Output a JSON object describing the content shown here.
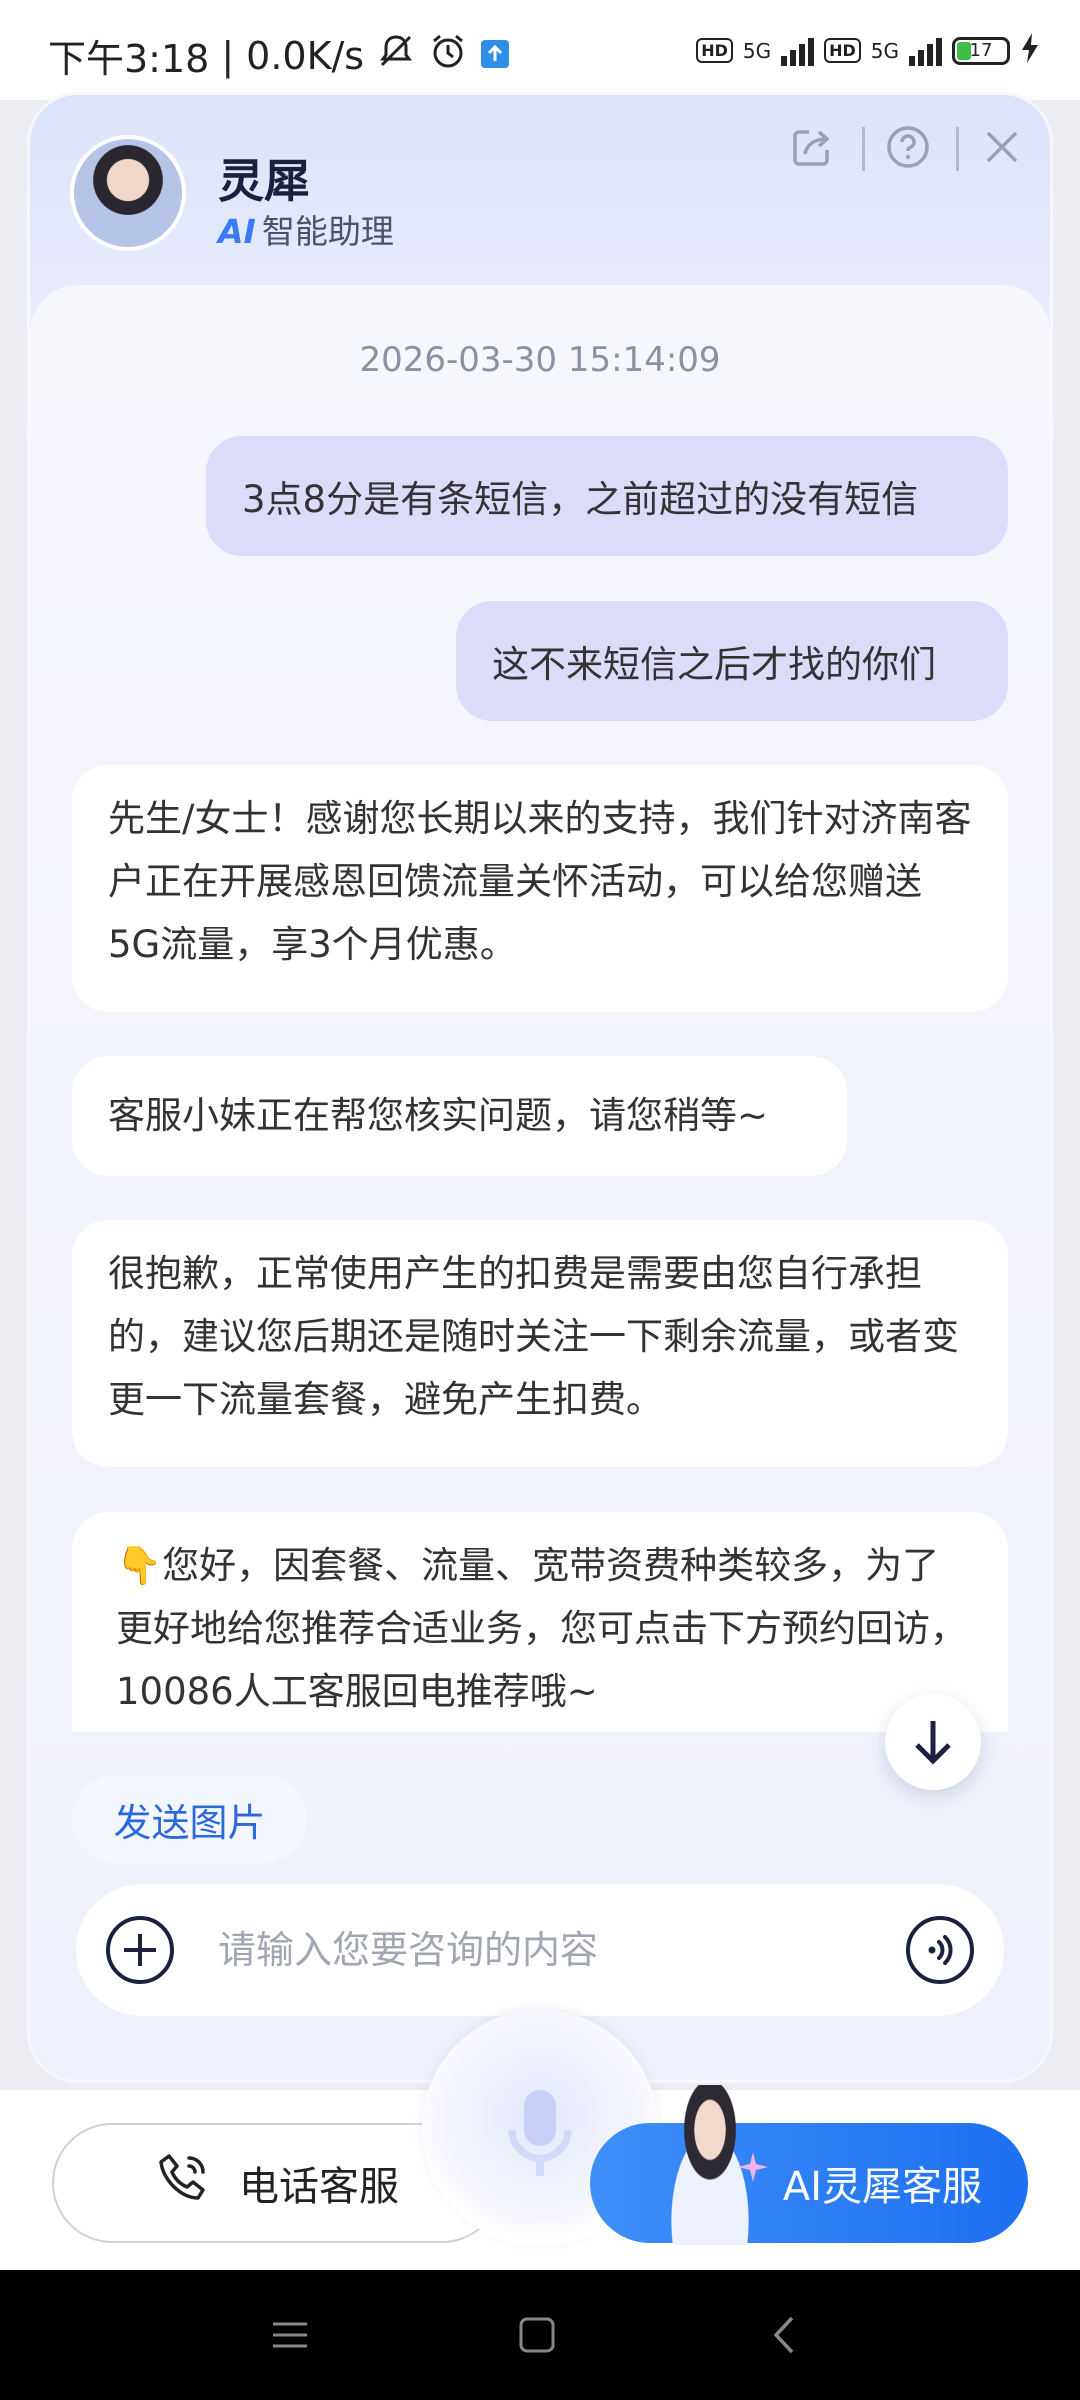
{
  "status_bar": {
    "time": "下午3:18",
    "speed": "0.0K/s",
    "network_1": "5G",
    "network_2": "5G",
    "battery": "17",
    "icons": [
      "mute-icon",
      "alarm-icon",
      "upload-notif-icon",
      "hd-icon",
      "signal-icon",
      "battery-icon",
      "charging-icon"
    ]
  },
  "header": {
    "bot_name": "灵犀",
    "bot_subtitle_ai": "AI",
    "bot_subtitle": "智能助理",
    "icons": [
      "share-icon",
      "help-icon",
      "close-icon"
    ]
  },
  "chat": {
    "timestamp": "2026-03-30 15:14:09",
    "messages": [
      {
        "role": "user",
        "text": "3点8分是有条短信，之前超过的没有短信"
      },
      {
        "role": "user",
        "text": "这不来短信之后才找的你们"
      },
      {
        "role": "bot",
        "text": "先生/女士！感谢您长期以来的支持，我们针对济南客户正在开展感恩回馈流量关怀活动，可以给您赠送5G流量，享3个月优惠。"
      },
      {
        "role": "bot",
        "text": "客服小妹正在帮您核实问题，请您稍等~"
      },
      {
        "role": "bot",
        "text": "很抱歉，正常使用产生的扣费是需要由您自行承担的，建议您后期还是随时关注一下剩余流量，或者变更一下流量套餐，避免产生扣费。"
      },
      {
        "role": "bot",
        "text": "👇您好，因套餐、流量、宽带资费种类较多，为了更好地给您推荐合适业务，您可点击下方预约回访，10086人工客服回电推荐哦~"
      }
    ]
  },
  "quick_chip": "发送图片",
  "input": {
    "placeholder": "请输入您要咨询的内容"
  },
  "bottom_tabs": {
    "phone_service": "电话客服",
    "ai_service": "AI灵犀客服"
  },
  "colors": {
    "user_bubble": "#dcdbfa",
    "bot_bubble": "#ffffff",
    "accent_blue": "#1e6ff2",
    "chip_text": "#2b68d9"
  }
}
